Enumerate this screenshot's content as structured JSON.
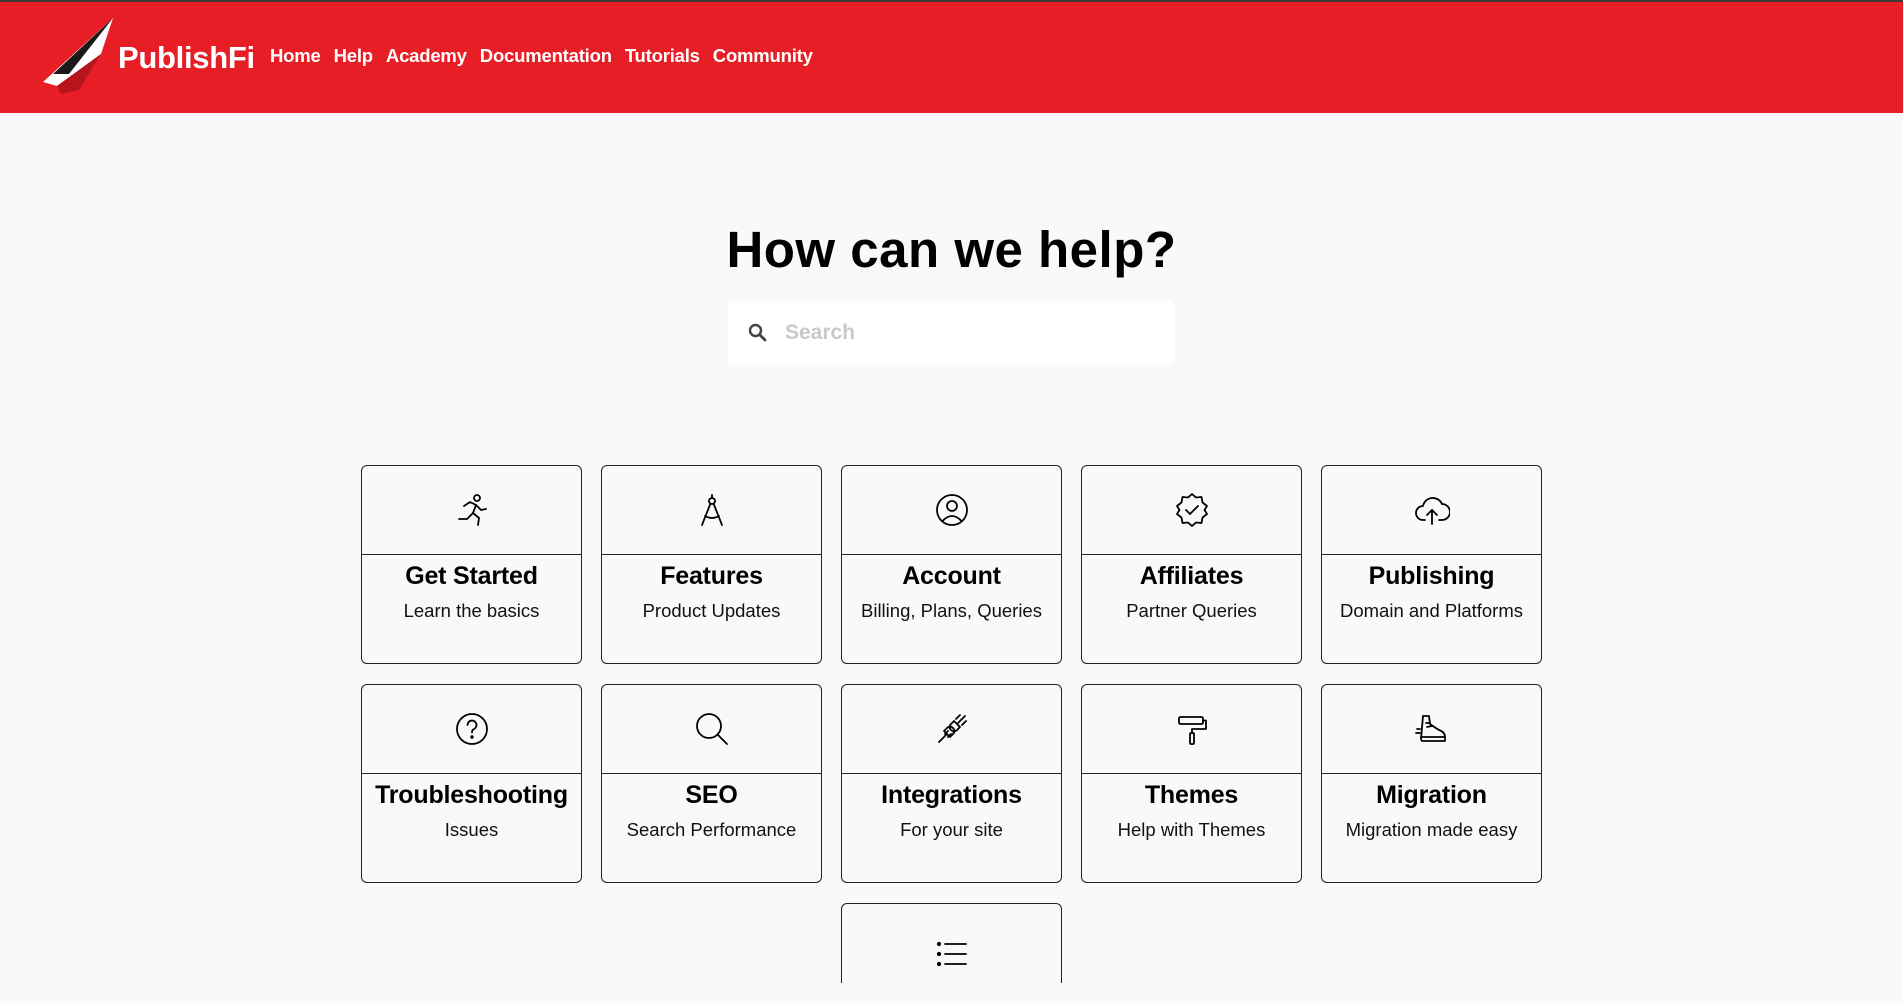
{
  "brand": {
    "name": "PublishFi",
    "accent_color": "#e81e26"
  },
  "nav": [
    {
      "label": "Home"
    },
    {
      "label": "Help"
    },
    {
      "label": "Academy"
    },
    {
      "label": "Documentation"
    },
    {
      "label": "Tutorials"
    },
    {
      "label": "Community"
    }
  ],
  "hero": {
    "title": "How can we help?"
  },
  "search": {
    "placeholder": "Search",
    "value": "",
    "icon": "search-icon"
  },
  "cards": [
    {
      "title": "Get Started",
      "subtitle": "Learn the basics",
      "icon": "running-person-icon"
    },
    {
      "title": "Features",
      "subtitle": "Product Updates",
      "icon": "compass-icon"
    },
    {
      "title": "Account",
      "subtitle": "Billing, Plans, Queries",
      "icon": "user-circle-icon"
    },
    {
      "title": "Affiliates",
      "subtitle": "Partner Queries",
      "icon": "badge-check-icon"
    },
    {
      "title": "Publishing",
      "subtitle": "Domain and Platforms",
      "icon": "cloud-upload-icon"
    },
    {
      "title": "Troubleshooting",
      "subtitle": "Issues",
      "icon": "help-circle-icon"
    },
    {
      "title": "SEO",
      "subtitle": "Search Performance",
      "icon": "magnifier-icon"
    },
    {
      "title": "Integrations",
      "subtitle": "For your site",
      "icon": "plug-icon"
    },
    {
      "title": "Themes",
      "subtitle": "Help with Themes",
      "icon": "paint-roller-icon"
    },
    {
      "title": "Migration",
      "subtitle": "Migration made easy",
      "icon": "sneaker-icon"
    },
    {
      "title": "",
      "subtitle": "",
      "icon": "list-icon"
    }
  ]
}
